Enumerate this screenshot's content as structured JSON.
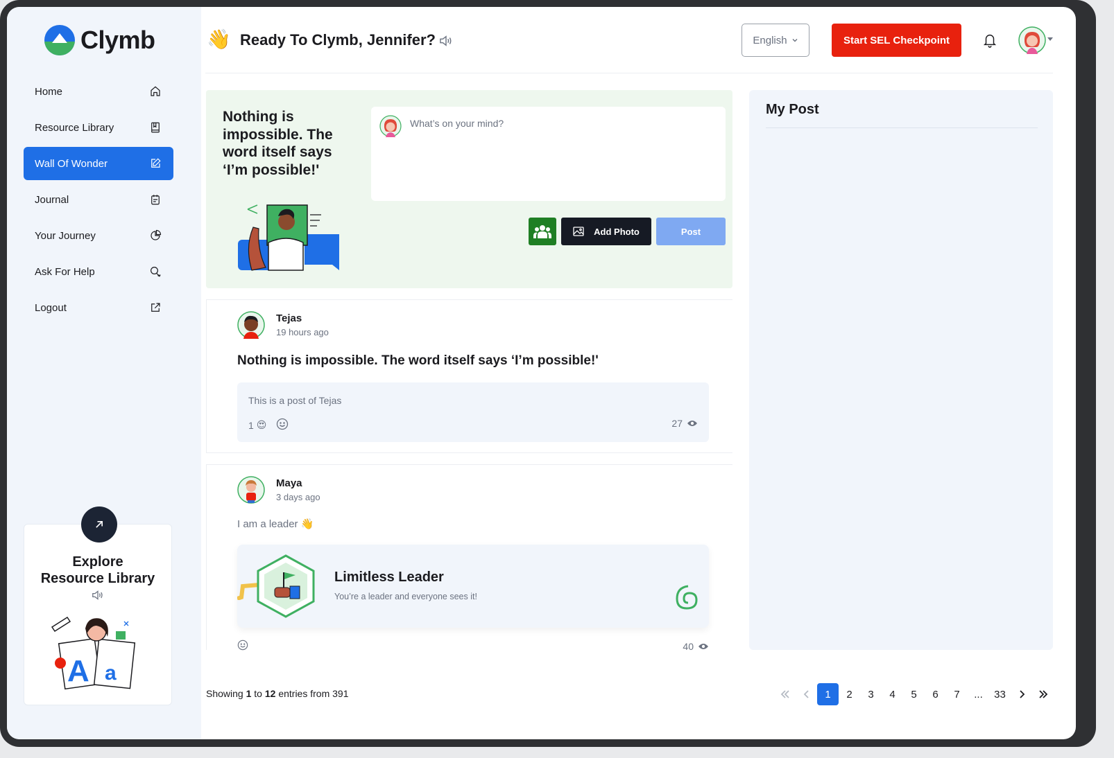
{
  "app": {
    "name": "Clymb"
  },
  "sidebar": {
    "items": [
      {
        "label": "Home",
        "icon": "home-icon",
        "active": false
      },
      {
        "label": "Resource Library",
        "icon": "book-icon",
        "active": false
      },
      {
        "label": "Wall Of Wonder",
        "icon": "edit-icon",
        "active": true
      },
      {
        "label": "Journal",
        "icon": "calendar-icon",
        "active": false
      },
      {
        "label": "Your Journey",
        "icon": "pie-chart-icon",
        "active": false
      },
      {
        "label": "Ask For Help",
        "icon": "chat-icon",
        "active": false
      },
      {
        "label": "Logout",
        "icon": "external-link-icon",
        "active": false
      }
    ],
    "explore": {
      "title_line1": "Explore",
      "title_line2": "Resource Library"
    }
  },
  "header": {
    "greeting": "Ready To Clymb, Jennifer?",
    "language": "English",
    "sel_button": "Start SEL Checkpoint"
  },
  "compose": {
    "quote": "Nothing is impossible. The word itself says ‘I’m possible!'",
    "placeholder": "What’s on your mind?",
    "add_photo": "Add Photo",
    "post": "Post"
  },
  "feed": {
    "posts": [
      {
        "author": "Tejas",
        "time": "19 hours ago",
        "headline": "Nothing is impossible. The word itself says ‘I’m possible!'",
        "body": "This is a post of Tejas",
        "reaction_count": "1",
        "views": "27"
      },
      {
        "author": "Maya",
        "time": "3 days ago",
        "text": "I am a leader",
        "badge_title": "Limitless Leader",
        "badge_subtitle": "You’re a leader and everyone sees it!",
        "views": "40"
      }
    ]
  },
  "my_post": {
    "title": "My Post"
  },
  "footer": {
    "showing_prefix": "Showing ",
    "from": "1",
    "to_word": " to ",
    "to": "12",
    "suffix": " entries from 391"
  },
  "pagination": {
    "pages": [
      "1",
      "2",
      "3",
      "4",
      "5",
      "6",
      "7",
      "...",
      "33"
    ],
    "current": "1"
  },
  "colors": {
    "primary": "#1f6fe6",
    "danger": "#e8210e",
    "success": "#1f7f24",
    "compose_bg": "#eef7ee",
    "panel_bg": "#f1f5fb"
  }
}
